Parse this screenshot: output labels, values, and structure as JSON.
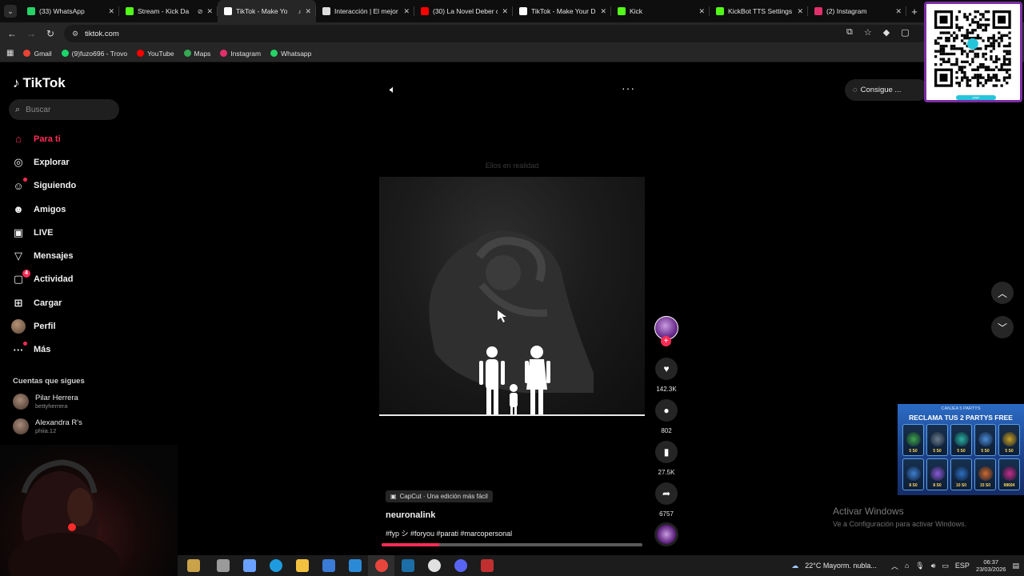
{
  "browser": {
    "tabs": [
      {
        "title": "(33) WhatsApp",
        "color": "#25d366"
      },
      {
        "title": "Stream - Kick Da",
        "color": "#53fc18"
      },
      {
        "title": "TikTok - Make Yo",
        "color": "#ffffff"
      },
      {
        "title": "Interacción | El mejor",
        "color": "#dddddd"
      },
      {
        "title": "(30) La Novel Deber c",
        "color": "#ff0000"
      },
      {
        "title": "TikTok - Make Your D",
        "color": "#ffffff"
      },
      {
        "title": "Kick",
        "color": "#53fc18"
      },
      {
        "title": "KickBot TTS Settings",
        "color": "#53fc18"
      },
      {
        "title": "(2) Instagram",
        "color": "#e1306c"
      }
    ],
    "new_tab": "+",
    "url": "tiktok.com",
    "bookmarks": [
      {
        "label": "Gmail",
        "color": "#ea4335"
      },
      {
        "label": "(9)fuzo696 - Trovo",
        "color": "#19d66b"
      },
      {
        "label": "YouTube",
        "color": "#ff0000"
      },
      {
        "label": "Maps",
        "color": "#34a853"
      },
      {
        "label": "Instagram",
        "color": "#e1306c"
      },
      {
        "label": "Whatsapp",
        "color": "#25d366"
      }
    ]
  },
  "tiktok": {
    "logo": "TikTok",
    "search_placeholder": "Buscar",
    "nav": [
      {
        "label": "Para ti",
        "icon": "home-icon",
        "active": true
      },
      {
        "label": "Explorar",
        "icon": "compass-icon"
      },
      {
        "label": "Siguiendo",
        "icon": "following-icon",
        "dot": true
      },
      {
        "label": "Amigos",
        "icon": "friends-icon"
      },
      {
        "label": "LIVE",
        "icon": "live-icon"
      },
      {
        "label": "Mensajes",
        "icon": "messages-icon"
      },
      {
        "label": "Actividad",
        "icon": "activity-icon",
        "badge": "4"
      },
      {
        "label": "Cargar",
        "icon": "upload-icon"
      },
      {
        "label": "Perfil",
        "icon": "profile-avatar"
      },
      {
        "label": "Más",
        "icon": "more-dots-icon",
        "dot": true
      }
    ],
    "following_title": "Cuentas que sigues",
    "following": [
      {
        "name": "Pilar Herrera",
        "user": "bettyherrera"
      },
      {
        "name": "Alexandra R's",
        "user": "phiia.12"
      }
    ],
    "get_app": "Consigue ...",
    "video": {
      "caption_top": "Ellos en realidad",
      "capcut": "CapCut · Una edición más fácil",
      "author": "neuronalink",
      "hashtags": "#fyp シ #foryou #parati #marcopersonal",
      "progress": 0.22,
      "likes": "142.3K",
      "comments": "802",
      "saves": "27.5K",
      "shares": "6757"
    }
  },
  "overlays": {
    "qr_brand": "yape",
    "ad_subtitle": "CANJEA 5 PARTYS",
    "ad_title": "RECLAMA TUS 2 PARTYS FREE",
    "ad_cards": [
      {
        "price": "5 S0",
        "color": "#3fa34d"
      },
      {
        "price": "5 S0",
        "color": "#6a7c8c"
      },
      {
        "price": "5 S0",
        "color": "#2bb0a3"
      },
      {
        "price": "5 S0",
        "color": "#4a8bd6"
      },
      {
        "price": "5 S0",
        "color": "#c9a227"
      },
      {
        "price": "8 S0",
        "color": "#3f7fd0"
      },
      {
        "price": "8 S0",
        "color": "#8b5bd6"
      },
      {
        "price": "10 S0",
        "color": "#2f6fc0"
      },
      {
        "price": "15 S0",
        "color": "#d06a2f"
      },
      {
        "price": "98694",
        "color": "#c02f8b"
      }
    ],
    "activate_title": "Activar Windows",
    "activate_sub": "Ve a Configuración para activar Windows."
  },
  "taskbar": {
    "weather": "22°C  Mayorm. nubla...",
    "lang": "ESP",
    "time": "06:37",
    "date": "23/03/2026",
    "icons": [
      {
        "name": "widget-icon",
        "color": "#c9a24a"
      },
      {
        "name": "task-view-icon",
        "color": "#9a9a9a"
      },
      {
        "name": "copilot-icon",
        "color": "#6aa0ff"
      },
      {
        "name": "edge-icon",
        "color": "#1e9be0"
      },
      {
        "name": "file-explorer-icon",
        "color": "#f3c140"
      },
      {
        "name": "store-icon",
        "color": "#3a7bd5"
      },
      {
        "name": "mail-icon",
        "color": "#2a8ad8"
      },
      {
        "name": "chrome-icon",
        "color": "#e8453c"
      },
      {
        "name": "steam-icon",
        "color": "#1b6ea8"
      },
      {
        "name": "obs-icon",
        "color": "#e0e0e0"
      },
      {
        "name": "discord-icon",
        "color": "#5865f2"
      },
      {
        "name": "app-icon",
        "color": "#c03030"
      }
    ]
  }
}
